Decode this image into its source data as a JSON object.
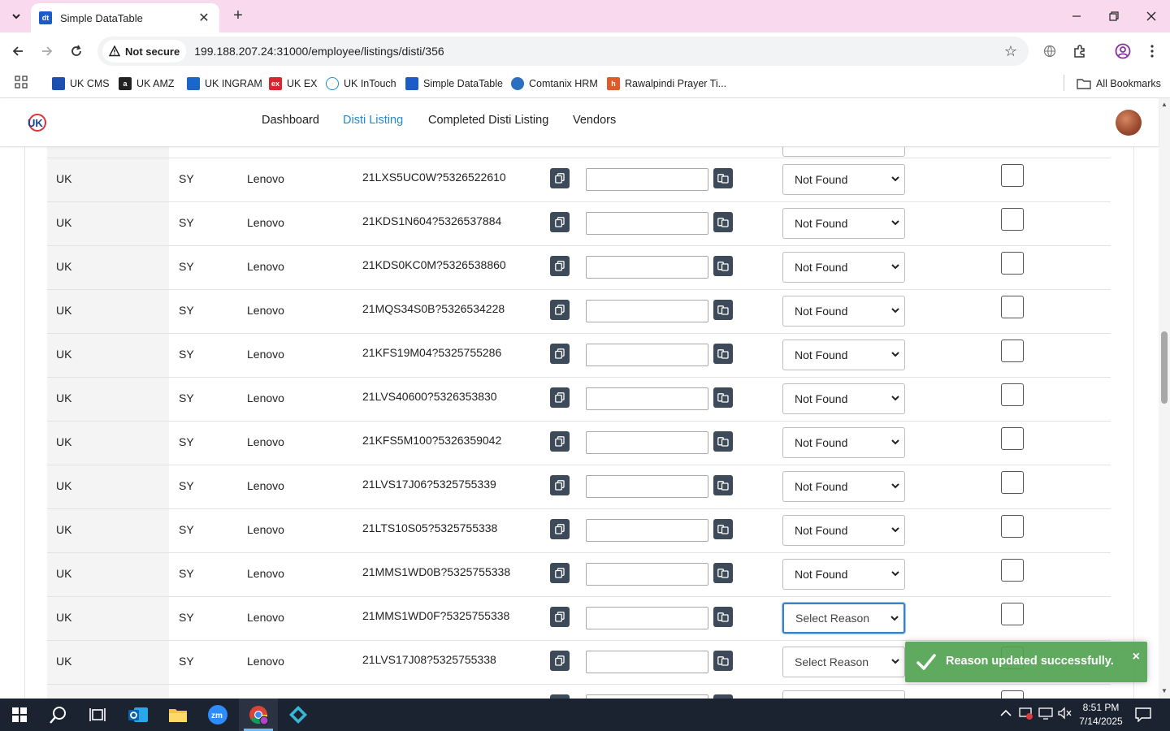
{
  "browser": {
    "tab_title": "Simple DataTable",
    "tab_favicon_text": "dt",
    "security_label": "Not secure",
    "url": "199.188.207.24:31000/employee/listings/disti/356"
  },
  "bookmarks": [
    {
      "label": "UK CMS",
      "icon": "uk-cms-icon",
      "color": "#1d4fb0"
    },
    {
      "label": "UK AMZ",
      "icon": "amazon-icon",
      "color": "#222222"
    },
    {
      "label": "UK INGRAM",
      "icon": "ingram-icon",
      "color": "#1b66c9"
    },
    {
      "label": "UK EX",
      "icon": "ex-icon",
      "color": "#d8262e"
    },
    {
      "label": "UK InTouch",
      "icon": "intouch-icon",
      "color": "#1a8ed6"
    },
    {
      "label": "Simple DataTable",
      "icon": "datatable-icon",
      "color": "#1d5bc9"
    },
    {
      "label": "Comtanix HRM",
      "icon": "comtanix-icon",
      "color": "#2a6fc0"
    },
    {
      "label": "Rawalpindi Prayer Ti...",
      "icon": "prayer-icon",
      "color": "#e05a2a"
    },
    {
      "label": "All Bookmarks",
      "icon": "folder-icon",
      "color": "#444444"
    }
  ],
  "nav": {
    "dashboard": "Dashboard",
    "disti_listing": "Disti Listing",
    "completed": "Completed Disti Listing",
    "vendors": "Vendors",
    "active_color": "#2389d6"
  },
  "rows": [
    {
      "country": "UK",
      "code": "SY",
      "brand": "Lenovo",
      "sku": "21LXS5UC0W?5326522610",
      "reason": "Not Found"
    },
    {
      "country": "UK",
      "code": "SY",
      "brand": "Lenovo",
      "sku": "21KDS1N604?5326537884",
      "reason": "Not Found"
    },
    {
      "country": "UK",
      "code": "SY",
      "brand": "Lenovo",
      "sku": "21KDS0KC0M?5326538860",
      "reason": "Not Found"
    },
    {
      "country": "UK",
      "code": "SY",
      "brand": "Lenovo",
      "sku": "21MQS34S0B?5326534228",
      "reason": "Not Found"
    },
    {
      "country": "UK",
      "code": "SY",
      "brand": "Lenovo",
      "sku": "21KFS19M04?5325755286",
      "reason": "Not Found"
    },
    {
      "country": "UK",
      "code": "SY",
      "brand": "Lenovo",
      "sku": "21LVS40600?5326353830",
      "reason": "Not Found"
    },
    {
      "country": "UK",
      "code": "SY",
      "brand": "Lenovo",
      "sku": "21KFS5M100?5326359042",
      "reason": "Not Found"
    },
    {
      "country": "UK",
      "code": "SY",
      "brand": "Lenovo",
      "sku": "21LVS17J06?5325755339",
      "reason": "Not Found"
    },
    {
      "country": "UK",
      "code": "SY",
      "brand": "Lenovo",
      "sku": "21LTS10S05?5325755338",
      "reason": "Not Found"
    },
    {
      "country": "UK",
      "code": "SY",
      "brand": "Lenovo",
      "sku": "21MMS1WD0B?5325755338",
      "reason": "Not Found"
    },
    {
      "country": "UK",
      "code": "SY",
      "brand": "Lenovo",
      "sku": "21MMS1WD0F?5325755338",
      "reason": "Select Reason"
    },
    {
      "country": "UK",
      "code": "SY",
      "brand": "Lenovo",
      "sku": "21LVS17J08?5325755338",
      "reason": "Select Reason"
    }
  ],
  "toast": {
    "message": "Reason updated successfully.",
    "close": "×",
    "color": "#51a351"
  },
  "taskbar": {
    "time": "8:51 PM",
    "date": "7/14/2025"
  }
}
